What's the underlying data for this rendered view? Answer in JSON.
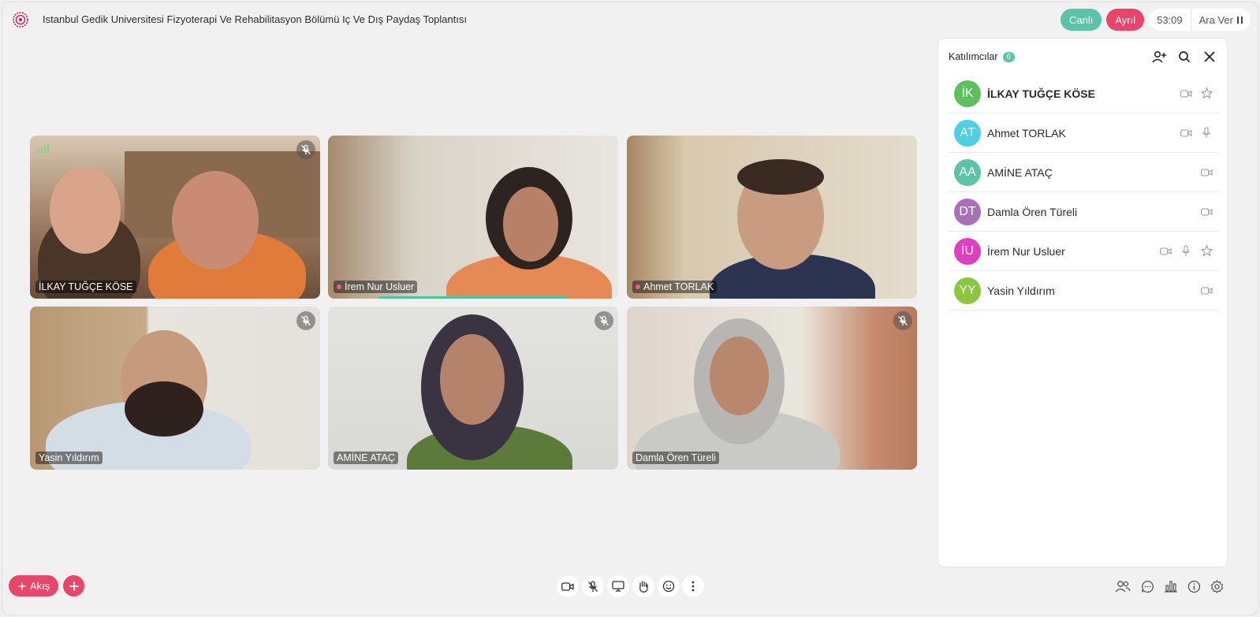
{
  "header": {
    "title": "Istanbul Gedik Universitesi Fizyoterapi Ve Rehabilitasyon Bölümü Iç Ve Dış Paydaş Toplantısı",
    "live_label": "Canlı",
    "record_label": "Ayrıl",
    "timer": "53:09",
    "pause_label": "Ara Ver"
  },
  "tiles": [
    {
      "name": "İLKAY TUĞÇE KÖSE",
      "muted": true,
      "speaking": false
    },
    {
      "name": "İrem Nur Usluer",
      "muted": false,
      "speaking": true
    },
    {
      "name": "Ahmet TORLAK",
      "muted": false,
      "speaking": false
    },
    {
      "name": "Yasin Yıldırım",
      "muted": true,
      "speaking": false
    },
    {
      "name": "AMİNE ATAÇ",
      "muted": true,
      "speaking": false
    },
    {
      "name": "Damla Ören Türeli",
      "muted": true,
      "speaking": false
    }
  ],
  "panel": {
    "title": "Katılımcılar",
    "count": "6",
    "participants": [
      {
        "initials": "İK",
        "name": "İLKAY TUĞÇE KÖSE",
        "color": "#5cc05f",
        "bold": true
      },
      {
        "initials": "AT",
        "name": "Ahmet TORLAK",
        "color": "#4dd0e1",
        "bold": false
      },
      {
        "initials": "AA",
        "name": "AMİNE ATAÇ",
        "color": "#5cc4a6",
        "bold": false
      },
      {
        "initials": "DT",
        "name": "Damla Ören Türeli",
        "color": "#a970b8",
        "bold": false
      },
      {
        "initials": "İU",
        "name": "İrem Nur Usluer",
        "color": "#e03fbf",
        "bold": false
      },
      {
        "initials": "YY",
        "name": "Yasin Yıldırım",
        "color": "#8bc63f",
        "bold": false
      }
    ]
  },
  "bottom": {
    "flow_label": "Akış"
  },
  "colors": {
    "accent": "#e8456b",
    "live": "#5cc4a6"
  }
}
